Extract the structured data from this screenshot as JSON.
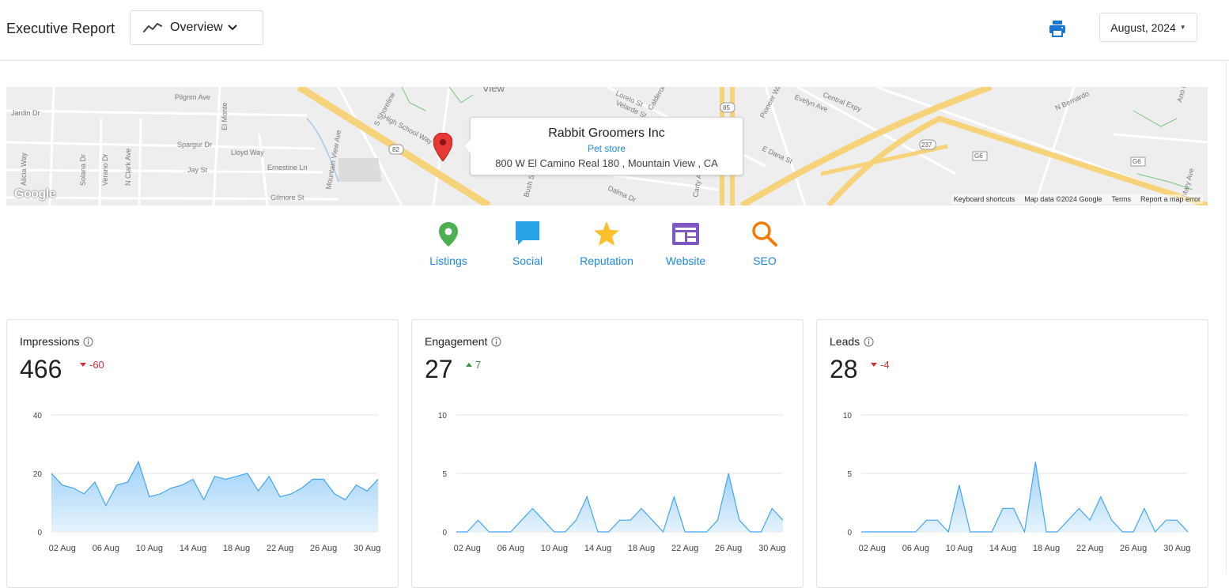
{
  "header": {
    "title": "Executive Report",
    "view_label": "Overview",
    "date_label": "August, 2024"
  },
  "map": {
    "business_name": "Rabbit Groomers Inc",
    "category": "Pet store",
    "address": "800 W El Camino Real 180 , Mountain View , CA",
    "logo_text": "Google",
    "footer": [
      "Keyboard shortcuts",
      "Map data ©2024 Google",
      "Terms",
      "Report a map error"
    ],
    "labels": [
      "Pilgrim Ave",
      "Jardin Dr",
      "Spargur Dr",
      "Lloyd Way",
      "Jay St",
      "Ernestine Ln",
      "Gilmore St",
      "El Monte",
      "N Clark Ave",
      "Verano Dr",
      "Solana Dr",
      "Alicia Way",
      "High School Way",
      "S Shoreline",
      "Mountain View Ave",
      "View",
      "Loreto St",
      "Velarde St",
      "Calderon",
      "Pioneer Way",
      "Evelyn Ave",
      "Central Expy",
      "E Dana St",
      "Dalma Dr",
      "Bush St",
      "Carty Av",
      "N Bernardo",
      "Ano Nuevo",
      "Mary Ave"
    ],
    "shields": [
      "82",
      "85",
      "237",
      "G6",
      "G6"
    ]
  },
  "nav": [
    {
      "label": "Listings",
      "icon": "location-pin-icon",
      "color": "#4caf50"
    },
    {
      "label": "Social",
      "icon": "chat-bubble-icon",
      "color": "#29a3e8"
    },
    {
      "label": "Reputation",
      "icon": "star-icon",
      "color": "#fbc02d"
    },
    {
      "label": "Website",
      "icon": "website-icon",
      "color": "#7e57c2"
    },
    {
      "label": "SEO",
      "icon": "magnifier-icon",
      "color": "#f57c00"
    }
  ],
  "cards": [
    {
      "title": "Impressions",
      "value": "466",
      "delta": "-60",
      "direction": "down"
    },
    {
      "title": "Engagement",
      "value": "27",
      "delta": "7",
      "direction": "up"
    },
    {
      "title": "Leads",
      "value": "28",
      "delta": "-4",
      "direction": "down"
    }
  ],
  "chart_data": [
    {
      "type": "area",
      "ylim": [
        0,
        40
      ],
      "yticks": [
        "0",
        "20",
        "40"
      ],
      "xticks": [
        "02 Aug",
        "06 Aug",
        "10 Aug",
        "14 Aug",
        "18 Aug",
        "22 Aug",
        "26 Aug",
        "30 Aug"
      ],
      "x": [
        "01 Aug",
        "02 Aug",
        "03 Aug",
        "04 Aug",
        "05 Aug",
        "06 Aug",
        "07 Aug",
        "08 Aug",
        "09 Aug",
        "10 Aug",
        "11 Aug",
        "12 Aug",
        "13 Aug",
        "14 Aug",
        "15 Aug",
        "16 Aug",
        "17 Aug",
        "18 Aug",
        "19 Aug",
        "20 Aug",
        "21 Aug",
        "22 Aug",
        "23 Aug",
        "24 Aug",
        "25 Aug",
        "26 Aug",
        "27 Aug",
        "28 Aug",
        "29 Aug",
        "30 Aug",
        "31 Aug"
      ],
      "values": [
        20,
        16,
        15,
        13,
        17,
        9,
        16,
        17,
        24,
        12,
        13,
        15,
        16,
        18,
        11,
        19,
        18,
        19,
        20,
        14,
        19,
        12,
        13,
        15,
        18,
        18,
        13,
        11,
        16,
        14,
        18
      ],
      "color": "#42a5f5"
    },
    {
      "type": "area",
      "ylim": [
        0,
        10
      ],
      "yticks": [
        "0",
        "5",
        "10"
      ],
      "xticks": [
        "02 Aug",
        "06 Aug",
        "10 Aug",
        "14 Aug",
        "18 Aug",
        "22 Aug",
        "26 Aug",
        "30 Aug"
      ],
      "x": [
        "01 Aug",
        "02 Aug",
        "03 Aug",
        "04 Aug",
        "05 Aug",
        "06 Aug",
        "07 Aug",
        "08 Aug",
        "09 Aug",
        "10 Aug",
        "11 Aug",
        "12 Aug",
        "13 Aug",
        "14 Aug",
        "15 Aug",
        "16 Aug",
        "17 Aug",
        "18 Aug",
        "19 Aug",
        "20 Aug",
        "21 Aug",
        "22 Aug",
        "23 Aug",
        "24 Aug",
        "25 Aug",
        "26 Aug",
        "27 Aug",
        "28 Aug",
        "29 Aug",
        "30 Aug",
        "31 Aug"
      ],
      "values": [
        0,
        0,
        1,
        0,
        0,
        0,
        1,
        2,
        1,
        0,
        0,
        1,
        3,
        0,
        0,
        1,
        1,
        2,
        1,
        0,
        3,
        0,
        0,
        0,
        1,
        5,
        1,
        0,
        0,
        2,
        1
      ],
      "color": "#42a5f5"
    },
    {
      "type": "area",
      "ylim": [
        0,
        10
      ],
      "yticks": [
        "0",
        "5",
        "10"
      ],
      "xticks": [
        "02 Aug",
        "06 Aug",
        "10 Aug",
        "14 Aug",
        "18 Aug",
        "22 Aug",
        "26 Aug",
        "30 Aug"
      ],
      "x": [
        "01 Aug",
        "02 Aug",
        "03 Aug",
        "04 Aug",
        "05 Aug",
        "06 Aug",
        "07 Aug",
        "08 Aug",
        "09 Aug",
        "10 Aug",
        "11 Aug",
        "12 Aug",
        "13 Aug",
        "14 Aug",
        "15 Aug",
        "16 Aug",
        "17 Aug",
        "18 Aug",
        "19 Aug",
        "20 Aug",
        "21 Aug",
        "22 Aug",
        "23 Aug",
        "24 Aug",
        "25 Aug",
        "26 Aug",
        "27 Aug",
        "28 Aug",
        "29 Aug",
        "30 Aug",
        "31 Aug"
      ],
      "values": [
        0,
        0,
        0,
        0,
        0,
        0,
        1,
        1,
        0,
        4,
        0,
        0,
        0,
        2,
        2,
        0,
        6,
        0,
        0,
        1,
        2,
        1,
        3,
        1,
        0,
        0,
        2,
        0,
        1,
        1,
        0
      ],
      "color": "#42a5f5"
    }
  ]
}
